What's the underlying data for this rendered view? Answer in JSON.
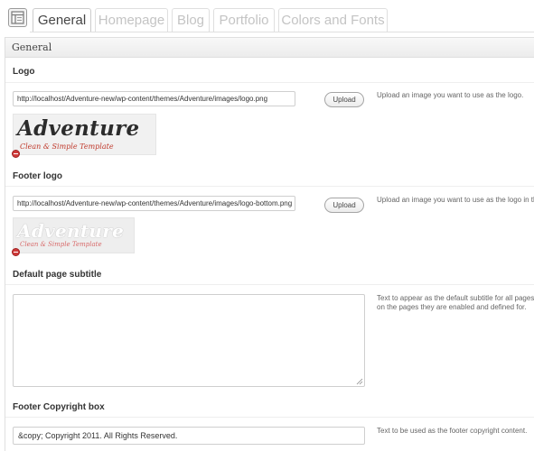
{
  "tabs": [
    {
      "label": "General",
      "active": true
    },
    {
      "label": "Homepage",
      "active": false
    },
    {
      "label": "Blog",
      "active": false
    },
    {
      "label": "Portfolio",
      "active": false
    },
    {
      "label": "Colors and Fonts",
      "active": false
    }
  ],
  "panel": {
    "title": "General"
  },
  "logo": {
    "title": "Logo",
    "value": "http://localhost/Adventure-new/wp-content/themes/Adventure/images/logo.png",
    "upload_label": "Upload",
    "description": "Upload an image you want to use as the logo.",
    "preview_text": "Adventure",
    "preview_sub": "Clean & Simple Template"
  },
  "footer_logo": {
    "title": "Footer logo",
    "value": "http://localhost/Adventure-new/wp-content/themes/Adventure/images/logo-bottom.png",
    "upload_label": "Upload",
    "description": "Upload an image you want to use as the logo in th",
    "preview_text": "Adventure",
    "preview_sub": "Clean & Simple Template"
  },
  "subtitle": {
    "title": "Default page subtitle",
    "value": "",
    "description_line1": "Text to appear as the default subtitle for all pages",
    "description_line2": "on the pages they are enabled and defined for."
  },
  "copyright": {
    "title": "Footer Copyright box",
    "value": "&copy; Copyright 2011. All Rights Reserved.",
    "description": "Text to be used as the footer copyright content."
  },
  "colors": {
    "logo_dark": "#2b2b2b",
    "logo_accent": "#c0392b",
    "logo_faded": "#ffffff",
    "logo_faded_sub": "#d86a6a",
    "remove": "#cf3b3b"
  }
}
